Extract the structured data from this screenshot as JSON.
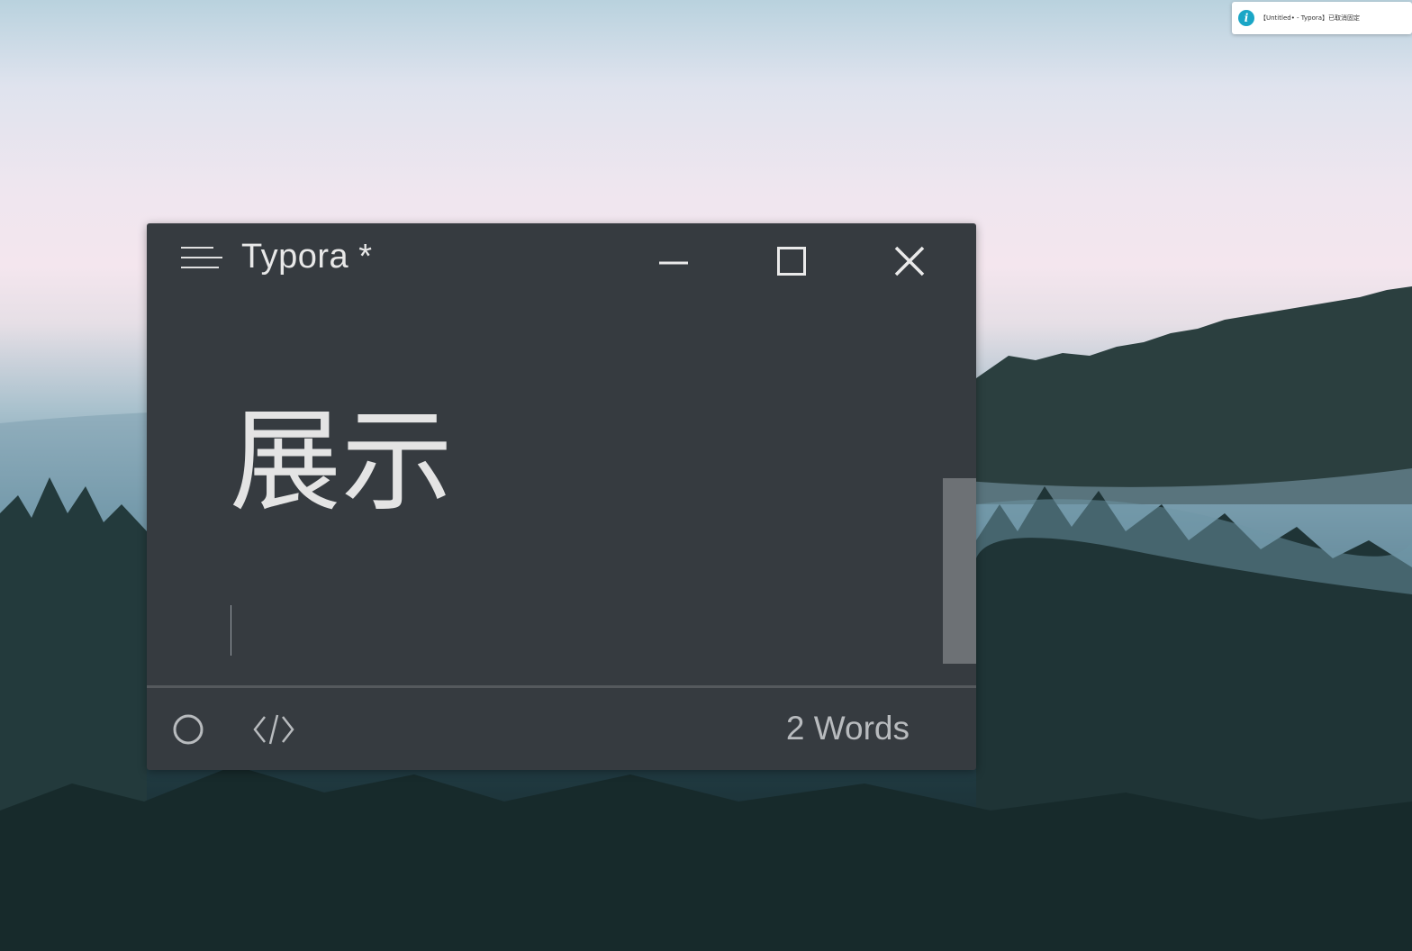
{
  "notification": {
    "icon": "info-icon",
    "text": "【Untitled• - Typora】已取消固定",
    "accent": "#1aa6c6"
  },
  "window": {
    "title": "Typora *",
    "background": "#363b40",
    "titlebar": {
      "menu_icon": "hamburger-menu-icon",
      "minimize_icon": "minimize-icon",
      "maximize_icon": "maximize-icon",
      "close_icon": "close-icon"
    },
    "editor": {
      "heading": "展示"
    },
    "statusbar": {
      "focus_icon": "focus-mode-icon",
      "source_icon": "source-code-icon",
      "word_count": "2 Words"
    }
  }
}
